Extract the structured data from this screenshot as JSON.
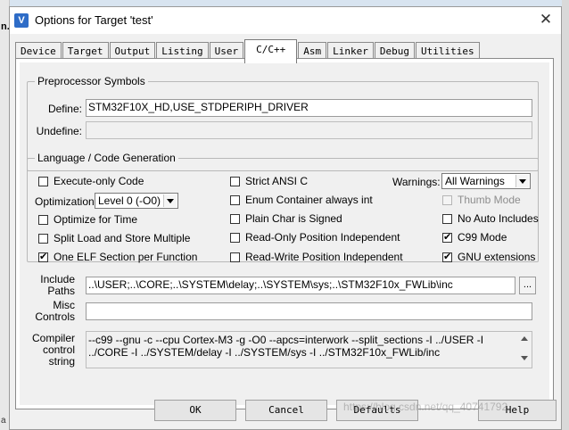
{
  "background": {
    "left_label": "n.",
    "bottom_left_label": "a"
  },
  "dialog": {
    "title": "Options for Target 'test'",
    "icon_letter": "V",
    "close_glyph": "✕"
  },
  "tabs": [
    {
      "label": "Device",
      "active": false
    },
    {
      "label": "Target",
      "active": false
    },
    {
      "label": "Output",
      "active": false
    },
    {
      "label": "Listing",
      "active": false
    },
    {
      "label": "User",
      "active": false
    },
    {
      "label": "C/C++",
      "active": true
    },
    {
      "label": "Asm",
      "active": false
    },
    {
      "label": "Linker",
      "active": false
    },
    {
      "label": "Debug",
      "active": false
    },
    {
      "label": "Utilities",
      "active": false
    }
  ],
  "preprocessor": {
    "legend": "Preprocessor Symbols",
    "define_label": "Define:",
    "define_value": "STM32F10X_HD,USE_STDPERIPH_DRIVER",
    "undefine_label": "Undefine:",
    "undefine_value": ""
  },
  "language": {
    "legend": "Language / Code Generation",
    "execute_only": {
      "label": "Execute-only Code",
      "checked": false
    },
    "optimization_label": "Optimization:",
    "optimization_value": "Level 0 (-O0)",
    "optimize_for_time": {
      "label": "Optimize for Time",
      "checked": false
    },
    "split_load_store": {
      "label": "Split Load and Store Multiple",
      "checked": false
    },
    "one_elf_section": {
      "label": "One ELF Section per Function",
      "checked": true
    },
    "strict_ansi": {
      "label": "Strict ANSI C",
      "checked": false
    },
    "enum_container": {
      "label": "Enum Container always int",
      "checked": false
    },
    "plain_char": {
      "label": "Plain Char is Signed",
      "checked": false
    },
    "ro_pi": {
      "label": "Read-Only Position Independent",
      "checked": false
    },
    "rw_pi": {
      "label": "Read-Write Position Independent",
      "checked": false
    },
    "warnings_label": "Warnings:",
    "warnings_value": "All Warnings",
    "thumb_mode": {
      "label": "Thumb Mode",
      "checked": false
    },
    "no_auto_includes": {
      "label": "No Auto Includes",
      "checked": false
    },
    "c99_mode": {
      "label": "C99 Mode",
      "checked": true
    },
    "gnu_extensions": {
      "label": "GNU extensions",
      "checked": true
    }
  },
  "include_paths": {
    "label_line1": "Include",
    "label_line2": "Paths",
    "value": "..\\USER;..\\CORE;..\\SYSTEM\\delay;..\\SYSTEM\\sys;..\\STM32F10x_FWLib\\inc",
    "browse_label": "..."
  },
  "misc_controls": {
    "label_line1": "Misc",
    "label_line2": "Controls",
    "value": ""
  },
  "compiler_control": {
    "label_line1": "Compiler",
    "label_line2": "control",
    "label_line3": "string",
    "value": "--c99 --gnu -c --cpu Cortex-M3 -g -O0 --apcs=interwork --split_sections -I ../USER -I ../CORE -I ../SYSTEM/delay -I ../SYSTEM/sys -I ../STM32F10x_FWLib/inc"
  },
  "buttons": {
    "ok": "OK",
    "cancel": "Cancel",
    "defaults": "Defaults",
    "help": "Help"
  },
  "watermark": "https://blog.csdn.net/qq_40741792"
}
